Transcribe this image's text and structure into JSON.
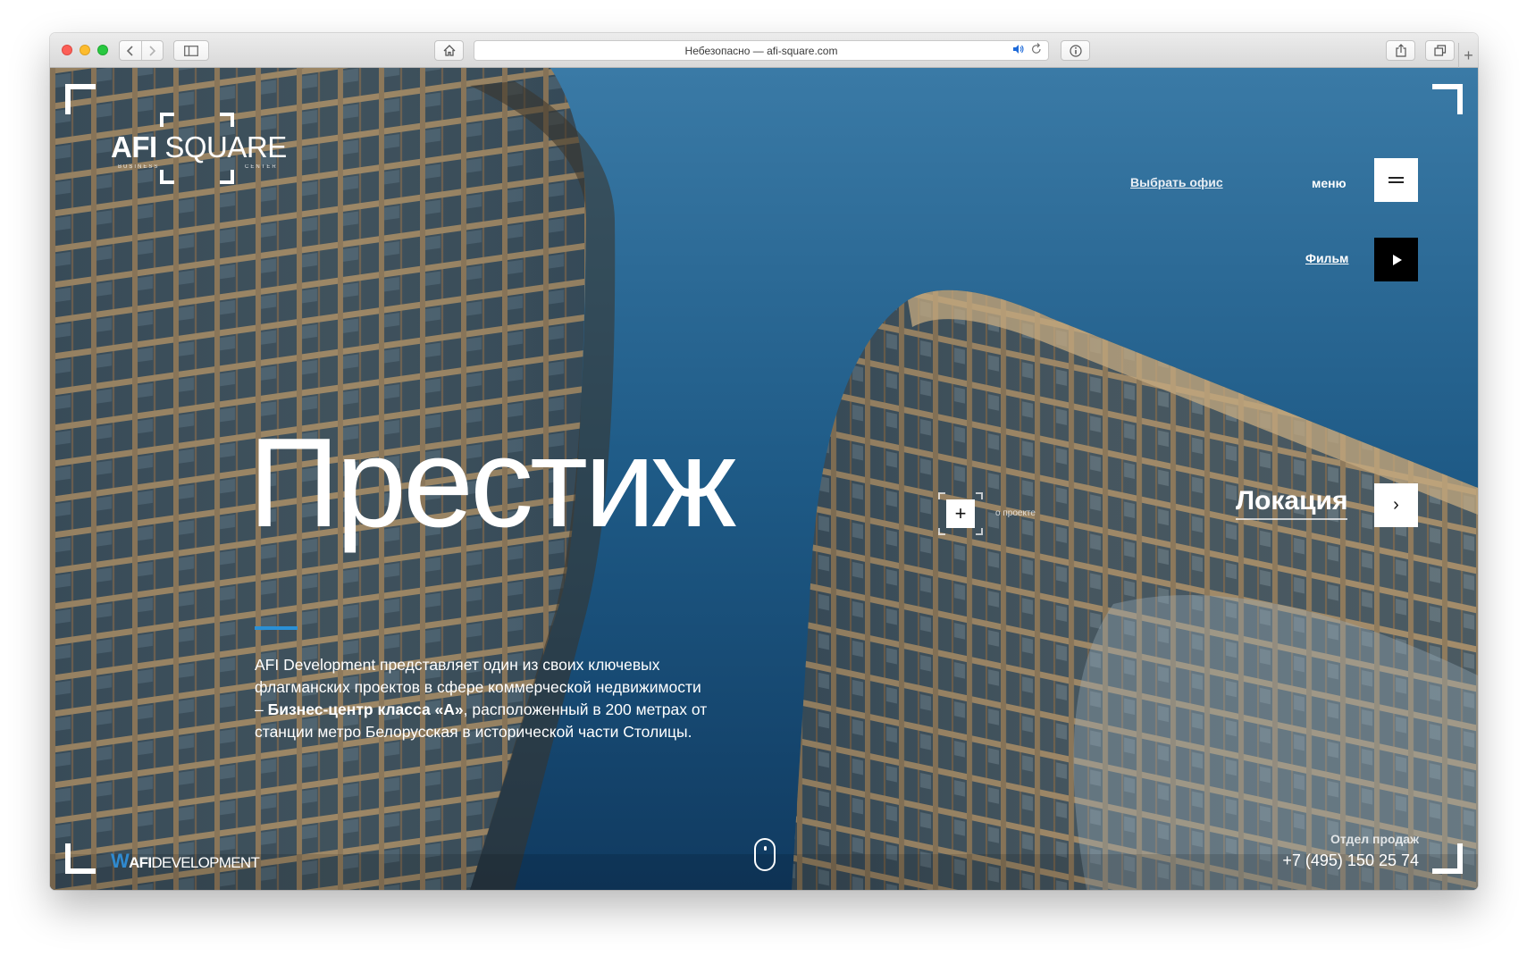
{
  "browser": {
    "address": "Небезопасно — afi-square.com"
  },
  "logo": {
    "afi": "AFI",
    "square": "SQUARE",
    "sub_left": "BUSINESS",
    "sub_right": "CENTER"
  },
  "header": {
    "choose_office": "Выбрать офис",
    "menu_label": "меню",
    "film_link": "Фильм"
  },
  "hero": {
    "headline": "Престиж",
    "description_part1": "AFI Development представляет один из своих ключевых флагманских проектов в сфере коммерческой недвижимости – ",
    "description_bold": "Бизнес-центр класса «А»",
    "description_part2": ", расположенный в 200 метрах от станции метро Белорусская в исторической части Столицы.",
    "about_plus": "+",
    "about_label": "о проекте",
    "location_label": "Локация",
    "next_arrow": "›"
  },
  "footer": {
    "dev_logo_w": "W",
    "dev_logo_afi": "AFI",
    "dev_logo_rest": "DEVELOPMENT",
    "sales_label": "Отдел продаж",
    "sales_phone": "+7 (495) 150 25 74"
  },
  "icons": {
    "back": "chevron-left-icon",
    "forward": "chevron-right-icon",
    "sidebar": "sidebar-icon",
    "home": "home-icon",
    "speaker": "speaker-icon",
    "reload": "reload-icon",
    "info": "info-icon",
    "share": "share-icon",
    "tabs": "tabs-icon",
    "new_tab": "plus-icon",
    "menu": "hamburger-icon",
    "play": "play-icon",
    "scroll": "mouse-scroll-icon"
  },
  "colors": {
    "sky": "#1d5782",
    "accent": "#2a90d6",
    "play_button": "#000000",
    "white_button": "#ffffff"
  }
}
